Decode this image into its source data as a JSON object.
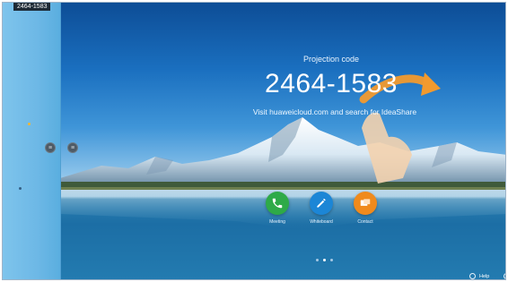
{
  "screen": {
    "code_tag": "2464-1583",
    "projection_label": "Projection code",
    "projection_code": "2464-1583",
    "instruction": "Visit huaweicloud.com and search for IdeaShare",
    "apps": [
      {
        "label": "Meeting",
        "icon": "phone-icon",
        "color": "#2eaa48"
      },
      {
        "label": "Whiteboard",
        "icon": "pen-icon",
        "color": "#1c86d6"
      },
      {
        "label": "Contact",
        "icon": "contact-icon",
        "color": "#f08a1c"
      }
    ],
    "page_indicator": {
      "total": 3,
      "current": 1
    },
    "help_label": "Help"
  }
}
